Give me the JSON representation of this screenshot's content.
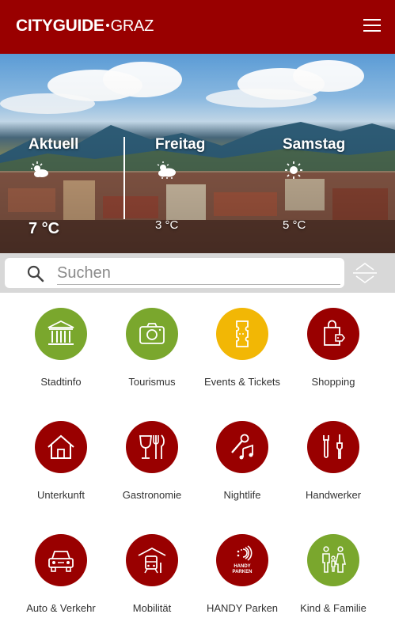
{
  "app": {
    "logo_city": "CITYGUIDE",
    "logo_graz": "GRAZ"
  },
  "weather": [
    {
      "day": "Aktuell",
      "temp": "7 °C",
      "icon": "partly-cloudy-icon"
    },
    {
      "day": "Freitag",
      "temp": "3 °C",
      "icon": "cloudy-icon"
    },
    {
      "day": "Samstag",
      "temp": "5 °C",
      "icon": "sun-icon"
    }
  ],
  "search": {
    "placeholder": "Suchen",
    "value": ""
  },
  "categories": [
    {
      "label": "Stadtinfo",
      "icon": "building-icon",
      "color": "#7aa72d"
    },
    {
      "label": "Tourismus",
      "icon": "camera-icon",
      "color": "#7aa72d"
    },
    {
      "label": "Events & Tickets",
      "icon": "ticket-icon",
      "color": "#f2b705"
    },
    {
      "label": "Shopping",
      "icon": "shopping-bag-icon",
      "color": "#990000"
    },
    {
      "label": "Unterkunft",
      "icon": "house-icon",
      "color": "#990000"
    },
    {
      "label": "Gastronomie",
      "icon": "glass-cutlery-icon",
      "color": "#990000"
    },
    {
      "label": "Nightlife",
      "icon": "microphone-music-icon",
      "color": "#990000"
    },
    {
      "label": "Handwerker",
      "icon": "tools-icon",
      "color": "#990000"
    },
    {
      "label": "Auto & Verkehr",
      "icon": "car-icon",
      "color": "#990000"
    },
    {
      "label": "Mobilität",
      "icon": "tram-icon",
      "color": "#990000"
    },
    {
      "label": "HANDY Parken",
      "icon": "handy-parken-icon",
      "color": "#990000",
      "icon_text": [
        "HANDY",
        "PARKEN"
      ]
    },
    {
      "label": "Kind & Familie",
      "icon": "family-icon",
      "color": "#7aa72d"
    }
  ],
  "colors": {
    "brand": "#990000",
    "green": "#7aa72d",
    "yellow": "#f2b705"
  }
}
